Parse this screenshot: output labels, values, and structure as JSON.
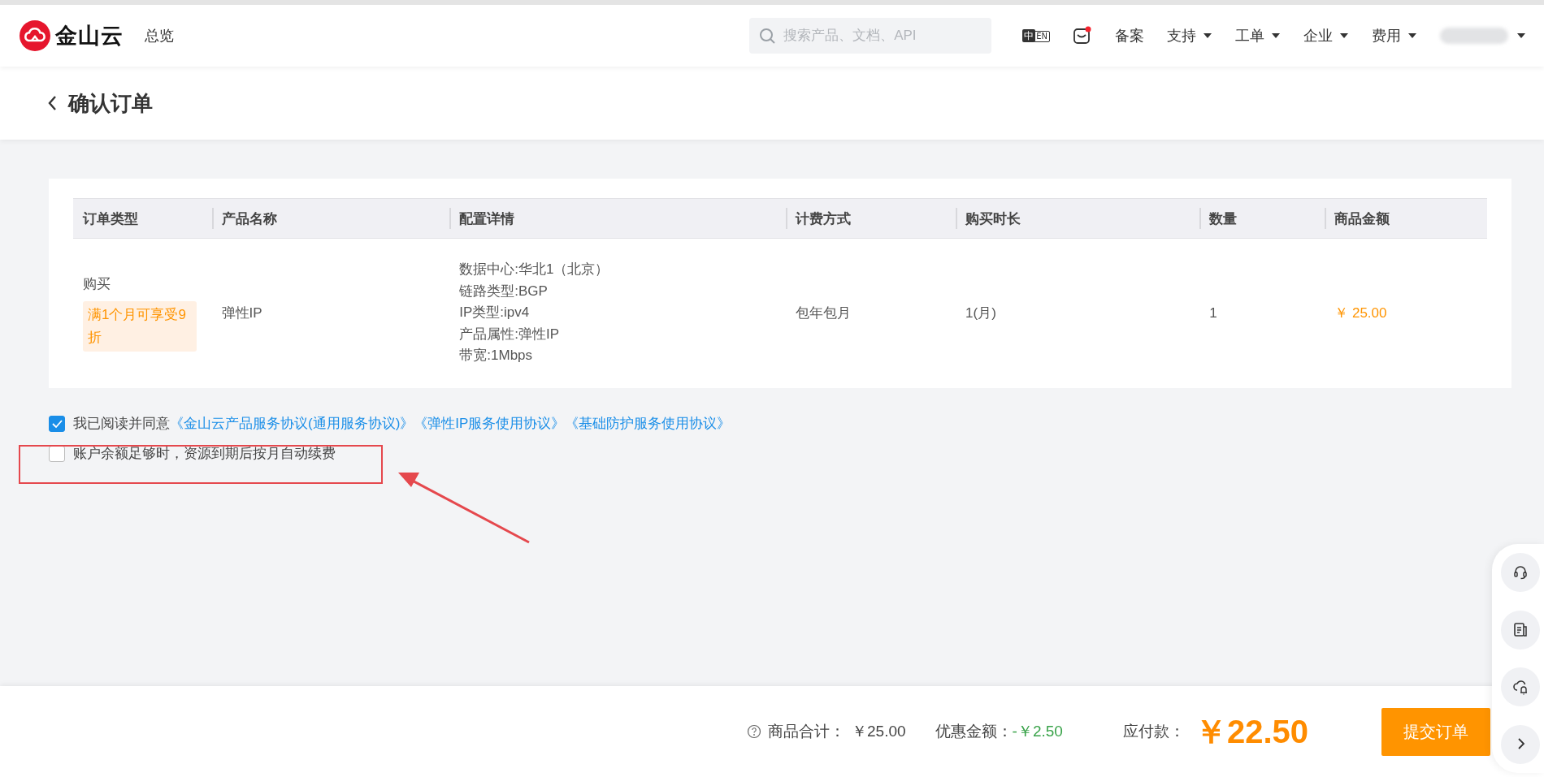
{
  "header": {
    "logo_text": "金山云",
    "nav_home": "总览",
    "search": {
      "placeholder": "搜索产品、文档、API"
    },
    "language_toggle": [
      "中",
      "EN"
    ],
    "notification_dot": true,
    "links": [
      {
        "label": "备案",
        "kind": "plain"
      },
      {
        "label": "支持",
        "kind": "dropdown"
      },
      {
        "label": "工单",
        "kind": "dropdown"
      },
      {
        "label": "企业",
        "kind": "dropdown"
      },
      {
        "label": "费用",
        "kind": "dropdown"
      }
    ]
  },
  "page": {
    "title": "确认订单"
  },
  "table": {
    "columns": [
      "订单类型",
      "产品名称",
      "配置详情",
      "计费方式",
      "购买时长",
      "数量",
      "商品金额"
    ],
    "rows": [
      {
        "order_type": "购买",
        "promo_tag": "满1个月可享受9折",
        "product": "弹性IP",
        "config": [
          "数据中心:华北1（北京）",
          "链路类型:BGP",
          "IP类型:ipv4",
          "产品属性:弹性IP",
          "带宽:1Mbps"
        ],
        "billing": "包年包月",
        "duration": "1(月)",
        "quantity": "1",
        "amount": "￥ 25.00"
      }
    ]
  },
  "agreements": [
    {
      "text": "我已阅读并同意",
      "links": [
        "《金山云产品服务协议(通用服务协议)》",
        "《弹性IP服务使用协议》",
        "《基础防护服务使用协议》"
      ],
      "checked": true
    },
    {
      "text": "账户余额足够时，资源到期后按月自动续费",
      "checked": false,
      "highlighted": true
    }
  ],
  "footer": {
    "subtotal_label": "商品合计：",
    "subtotal": "￥25.00",
    "discount_label": "优惠金额：",
    "discount": "-￥2.50",
    "payable_label": "应付款：",
    "payable": "￥22.50",
    "submit": "提交订单"
  }
}
